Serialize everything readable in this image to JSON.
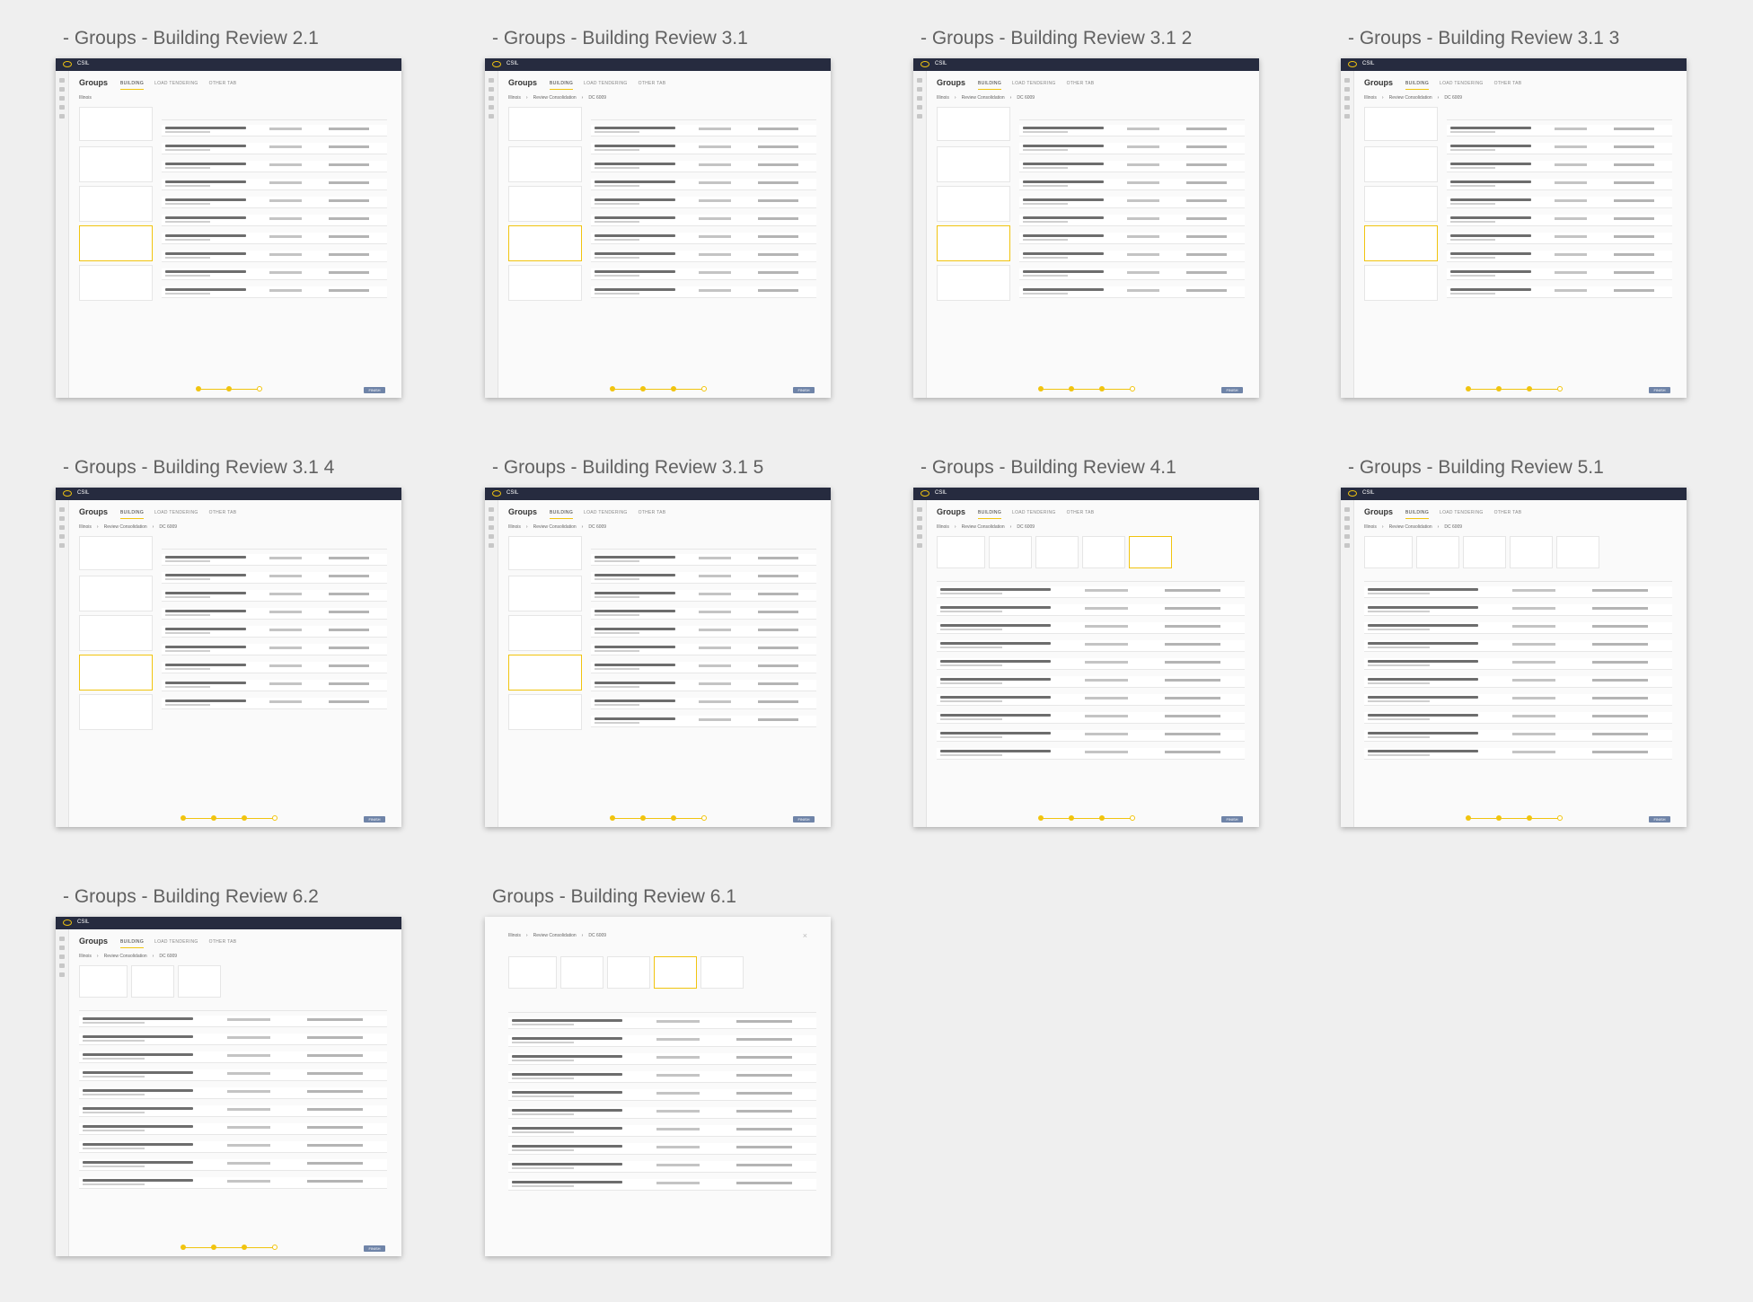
{
  "app": {
    "title": "Groups",
    "brand": "CSIL",
    "finish_label": "FINISH"
  },
  "tabs": [
    "BUILDING",
    "LOAD TENDERING",
    "OTHER TAB"
  ],
  "breadcrumb": [
    "Illinois",
    "Review Consolidation",
    "DC 6009"
  ],
  "colors": {
    "accent": "#f1c40f",
    "topbar": "#262b3f",
    "button": "#6f84a8",
    "background": "#efefef"
  },
  "frames": [
    {
      "title": "- Groups - Building Review 2.1",
      "layout": "left",
      "crumbs": [
        "Illinois"
      ],
      "selected": 2,
      "cards": 4,
      "rows": 10,
      "steps": 3,
      "done": 2
    },
    {
      "title": "- Groups - Building Review 3.1",
      "layout": "left",
      "crumbs": [
        "Illinois",
        "Review Consolidation",
        "DC 6009"
      ],
      "selected": 2,
      "cards": 4,
      "rows": 10,
      "steps": 4,
      "done": 3
    },
    {
      "title": "- Groups - Building Review 3.1 2",
      "layout": "left",
      "crumbs": [
        "Illinois",
        "Review Consolidation",
        "DC 6009"
      ],
      "selected": 2,
      "cards": 4,
      "rows": 10,
      "steps": 4,
      "done": 3
    },
    {
      "title": "- Groups - Building Review 3.1 3",
      "layout": "left",
      "crumbs": [
        "Illinois",
        "Review Consolidation",
        "DC 6009"
      ],
      "selected": 2,
      "cards": 4,
      "rows": 10,
      "steps": 4,
      "done": 3
    },
    {
      "title": "- Groups - Building Review 3.1 4",
      "layout": "left",
      "crumbs": [
        "Illinois",
        "Review Consolidation",
        "DC 6009"
      ],
      "selected": 2,
      "cards": 4,
      "rows": 9,
      "steps": 4,
      "done": 3
    },
    {
      "title": "- Groups - Building Review 3.1 5",
      "layout": "left",
      "crumbs": [
        "Illinois",
        "Review Consolidation",
        "DC 6009"
      ],
      "selected": 2,
      "cards": 4,
      "rows": 10,
      "steps": 4,
      "done": 3
    },
    {
      "title": "- Groups - Building Review 4.1",
      "layout": "top",
      "crumbs": [
        "Illinois",
        "Review Consolidation",
        "DC 6009"
      ],
      "selected": 3,
      "cards": 4,
      "rows": 10,
      "steps": 4,
      "done": 3
    },
    {
      "title": "- Groups - Building Review 5.1",
      "layout": "top",
      "crumbs": [
        "Illinois",
        "Review Consolidation",
        "DC 6009"
      ],
      "selected": -1,
      "cards": 4,
      "rows": 10,
      "steps": 4,
      "done": 3
    },
    {
      "title": "- Groups - Building Review 6.2",
      "layout": "top",
      "crumbs": [
        "Illinois",
        "Review Consolidation",
        "DC 6009"
      ],
      "selected": 2,
      "cards": 2,
      "rows": 10,
      "steps": 4,
      "done": 3
    },
    {
      "title": "Groups - Building Review 6.1",
      "layout": "modal",
      "crumbs": [
        "Illinois",
        "Review Consolidation",
        "DC 6009"
      ],
      "selected": 2,
      "cards": 4,
      "rows": 10,
      "steps": 0,
      "done": 0
    }
  ]
}
